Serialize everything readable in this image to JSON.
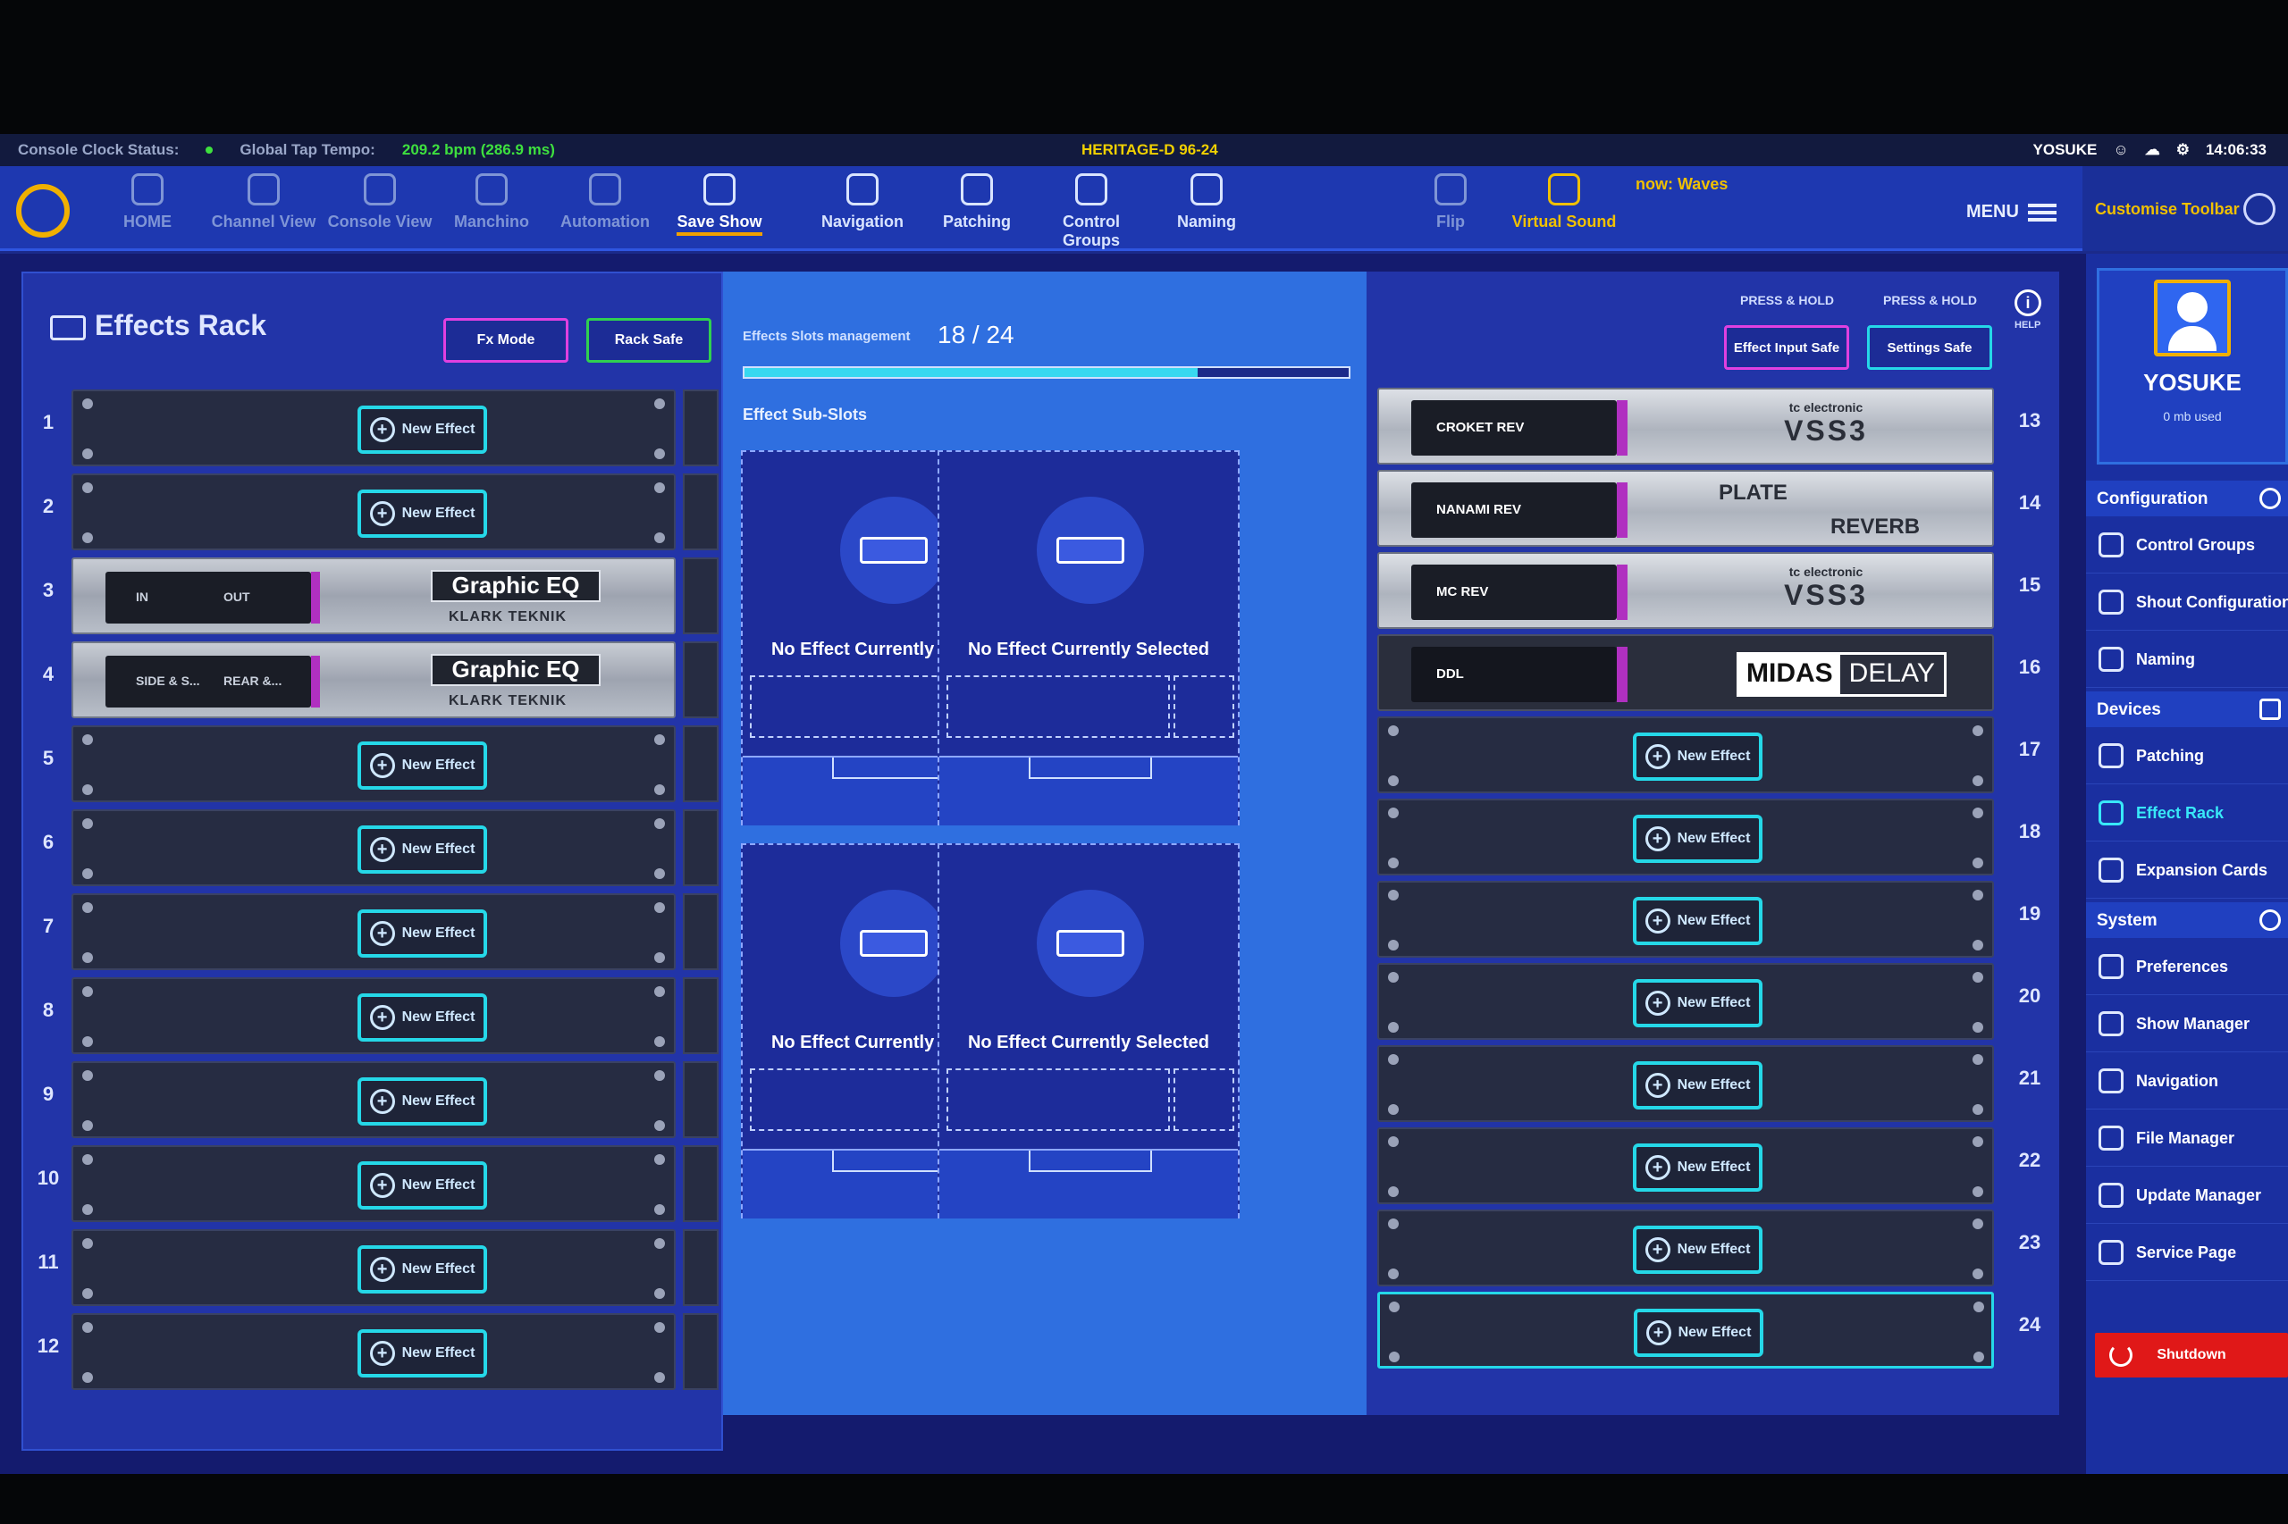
{
  "status_bar": {
    "console_clock": "Console Clock Status:",
    "tap_tempo_label": "Global Tap Tempo:",
    "tap_tempo_value": "209.2 bpm (286.9 ms)",
    "console_name": "HERITAGE-D 96-24",
    "user": "YOSUKE",
    "time": "14:06:33"
  },
  "toolbar": {
    "items": [
      {
        "label": "HOME",
        "icon": "home-icon"
      },
      {
        "label": "Channel View",
        "icon": "channel-view-icon"
      },
      {
        "label": "Console View",
        "icon": "console-view-icon"
      },
      {
        "label": "Manchino",
        "icon": "manchino-icon"
      },
      {
        "label": "Automation",
        "icon": "automation-icon"
      },
      {
        "label": "Save Show",
        "icon": "save-show-icon"
      },
      {
        "label": "Navigation",
        "icon": "navigation-icon"
      },
      {
        "label": "Patching",
        "icon": "patching-icon"
      },
      {
        "label": "Control Groups",
        "icon": "control-groups-icon"
      },
      {
        "label": "Naming",
        "icon": "naming-icon"
      },
      {
        "label": "Flip",
        "icon": "flip-icon"
      },
      {
        "label": "Virtual Sound",
        "icon": "virtual-sound-icon"
      }
    ],
    "now_label": "now: Waves",
    "menu": "MENU",
    "customise": "Customise Toolbar"
  },
  "effects_rack": {
    "title": "Effects Rack",
    "fx_mode": "Fx Mode",
    "rack_safe": "Rack Safe",
    "new_effect": "New Effect",
    "left_rows": [
      {
        "num": "1"
      },
      {
        "num": "2"
      },
      {
        "num": "3",
        "unit": "Graphic EQ",
        "sub": "KLARK TEKNIK",
        "in": "IN",
        "out": "OUT"
      },
      {
        "num": "4",
        "unit": "Graphic EQ",
        "sub": "KLARK TEKNIK",
        "in": "SIDE & S...",
        "out": "REAR &..."
      },
      {
        "num": "5"
      },
      {
        "num": "6"
      },
      {
        "num": "7"
      },
      {
        "num": "8"
      },
      {
        "num": "9"
      },
      {
        "num": "10"
      },
      {
        "num": "11"
      },
      {
        "num": "12"
      }
    ],
    "right_rows": [
      {
        "num": "13",
        "name": "CROKET REV",
        "brand_top": "tc electronic",
        "brand": "VSS3"
      },
      {
        "num": "14",
        "name": "NANAMI REV",
        "plate": "PLATE",
        "reverb": "REVERB"
      },
      {
        "num": "15",
        "name": "MC REV",
        "brand_top": "tc electronic",
        "brand": "VSS3"
      },
      {
        "num": "16",
        "name": "DDL",
        "brand_m": "MIDAS",
        "brand_d": "DELAY"
      },
      {
        "num": "17"
      },
      {
        "num": "18"
      },
      {
        "num": "19"
      },
      {
        "num": "20"
      },
      {
        "num": "21"
      },
      {
        "num": "22"
      },
      {
        "num": "23"
      },
      {
        "num": "24"
      }
    ]
  },
  "slots": {
    "title": "Effects Slots management",
    "count": "18 / 24",
    "used": 18,
    "total": 24,
    "sub_title": "Effect Sub-Slots",
    "empty_msg": "No Effect Currently Selected"
  },
  "right_header": {
    "press_hold": "PRESS & HOLD",
    "effect_input_safe": "Effect Input Safe",
    "settings_safe": "Settings Safe",
    "help": "HELP"
  },
  "sidebar": {
    "user": "YOSUKE",
    "usage": "0 mb used",
    "configuration": "Configuration",
    "config_items": [
      "Control Groups",
      "Shout Configuration",
      "Naming"
    ],
    "devices": "Devices",
    "device_items": [
      "Patching",
      "Effect Rack",
      "Expansion Cards"
    ],
    "system": "System",
    "system_items": [
      "Preferences",
      "Show Manager",
      "Navigation",
      "File Manager",
      "Update Manager",
      "Service Page"
    ],
    "shutdown": "Shutdown"
  },
  "colors": {
    "accent_cyan": "#25d8e8",
    "fx_mode_magenta": "#e040e0",
    "rack_safe_green": "#30d050",
    "save_show_underline": "#f0a000"
  }
}
